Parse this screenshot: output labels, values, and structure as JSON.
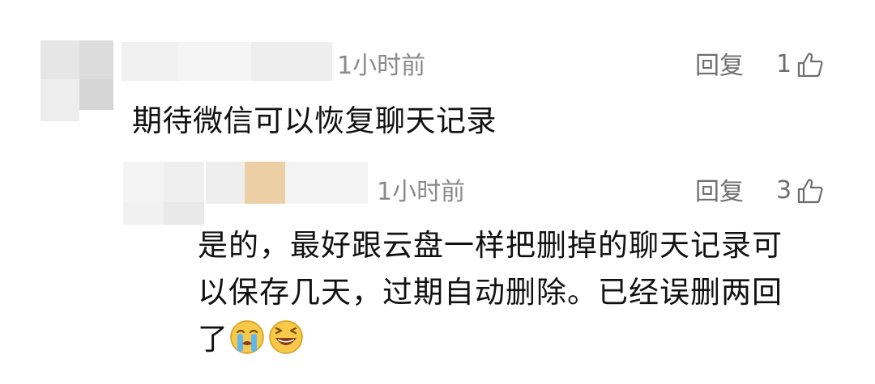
{
  "comments": [
    {
      "time": "1小时前",
      "reply_label": "回复",
      "like_count": "1",
      "text": "期待微信可以恢复聊天记录"
    },
    {
      "time": "1小时前",
      "reply_label": "回复",
      "like_count": "3",
      "text_lines": [
        "是的，最好跟云盘一样把删掉的聊天记录可",
        "以保存几天，过期自动删除。已经误删两回",
        "了"
      ]
    }
  ],
  "emojis": [
    "crying-emoji",
    "laughing-emoji"
  ],
  "colors": {
    "meta_text": "#8a8a8a",
    "action_text": "#6f6f6f",
    "body_text": "#111111"
  }
}
